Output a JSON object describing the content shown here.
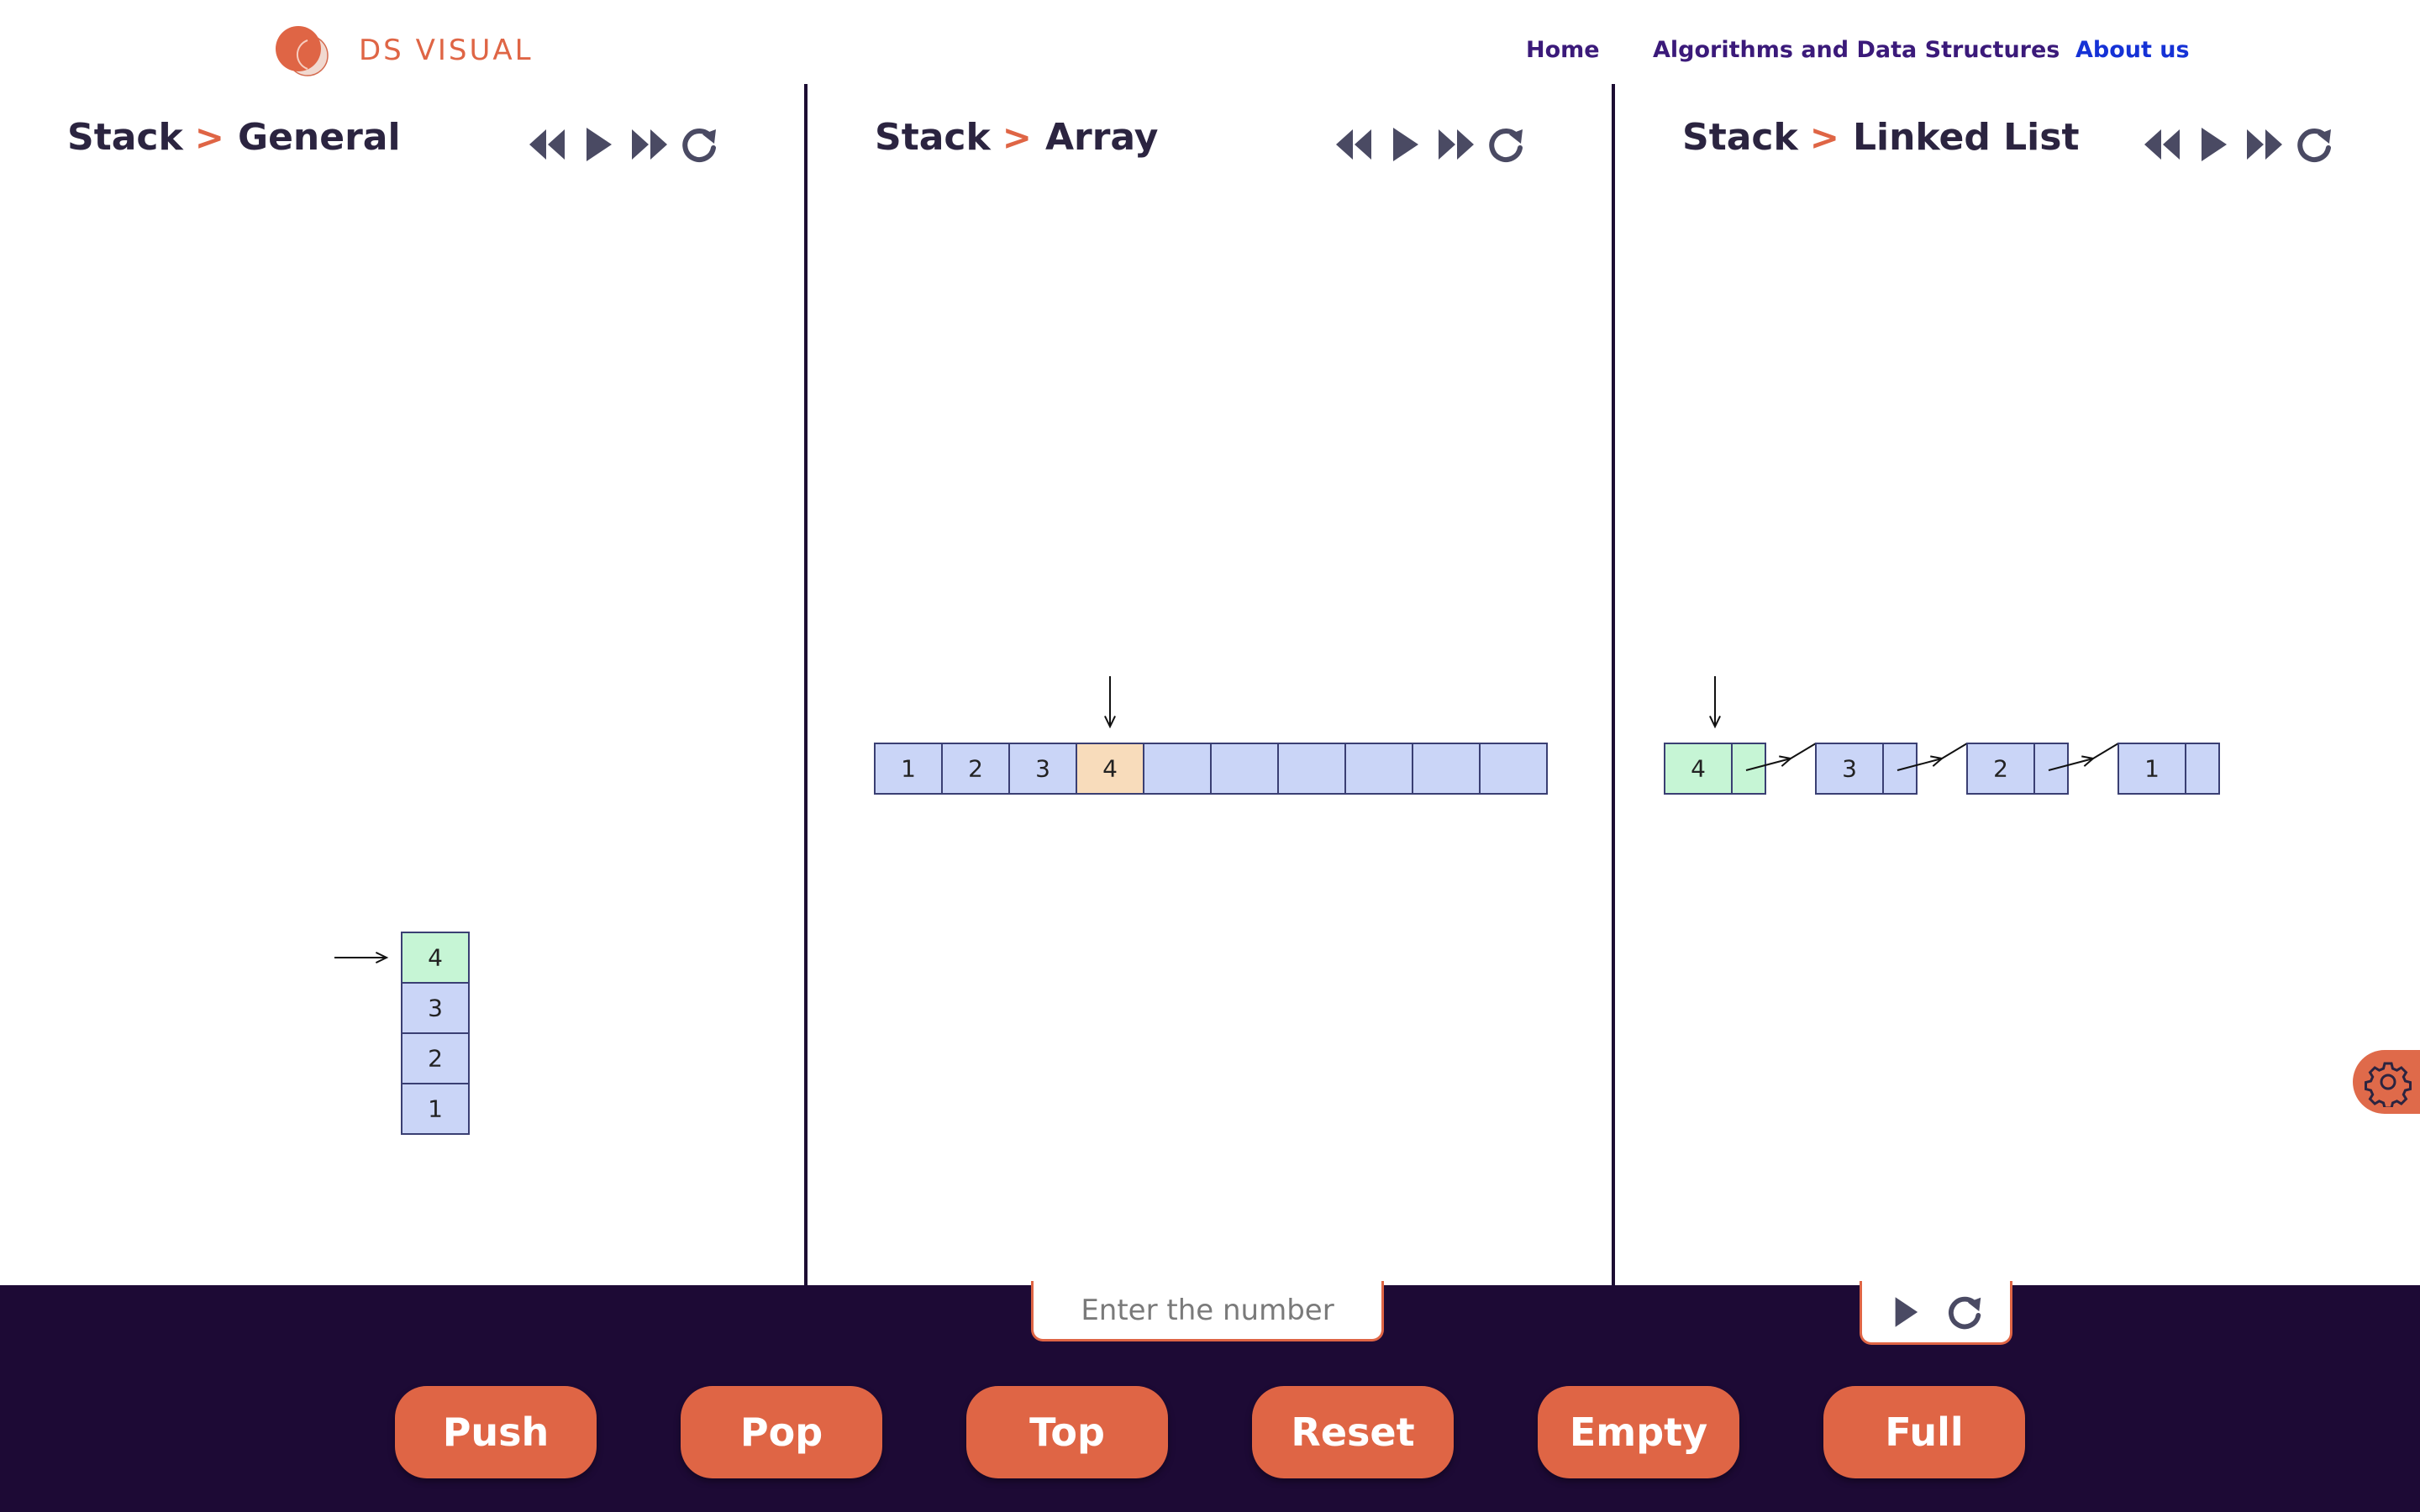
{
  "brand": {
    "name": "DS VISUAL"
  },
  "nav": {
    "items": [
      "Home",
      "Algorithms and Data Structures",
      "About us"
    ],
    "active_index": 2
  },
  "panels": [
    {
      "section": "Stack",
      "title": "General"
    },
    {
      "section": "Stack",
      "title": "Array"
    },
    {
      "section": "Stack",
      "title": "Linked List"
    }
  ],
  "general_stack": {
    "values": [
      "1",
      "2",
      "3",
      "4"
    ]
  },
  "array_stack": {
    "values": [
      "1",
      "2",
      "3",
      "4"
    ],
    "capacity": 10,
    "top_index": 3
  },
  "linked_list": {
    "nodes": [
      "4",
      "3",
      "2",
      "1"
    ]
  },
  "input": {
    "placeholder": "Enter the number",
    "value": ""
  },
  "operations": [
    "Push",
    "Pop",
    "Top",
    "Reset",
    "Empty",
    "Full"
  ],
  "colors": {
    "accent": "#df6545",
    "bottom_bar": "#1d0a35",
    "cell": "#cad5f7",
    "top_cell": "#c6f5d5",
    "array_top_cell": "#f8dcbb",
    "outline": "#3a3f73"
  },
  "icons": [
    "logo-icon",
    "rewind-icon",
    "play-icon",
    "fast-forward-icon",
    "reload-icon",
    "gear-icon"
  ]
}
